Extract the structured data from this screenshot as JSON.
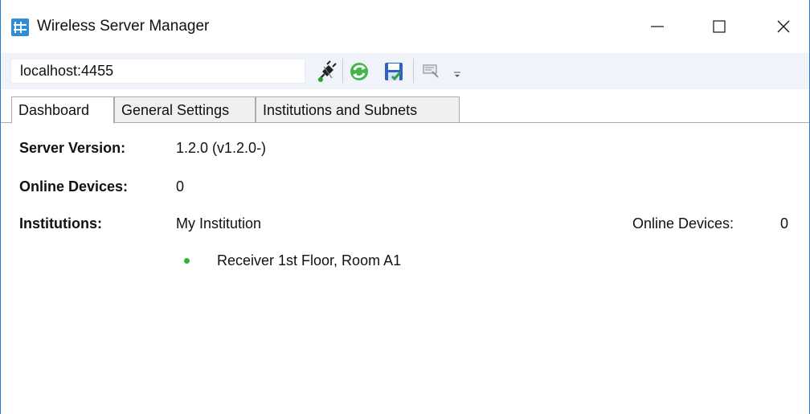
{
  "window": {
    "title": "Wireless Server Manager"
  },
  "toolbar": {
    "server_address": "localhost:4455",
    "buttons": [
      {
        "name": "disconnect",
        "icon": "plug-icon"
      },
      {
        "name": "refresh",
        "icon": "refresh-icon"
      },
      {
        "name": "save",
        "icon": "save-icon"
      },
      {
        "name": "options",
        "icon": "options-icon"
      }
    ]
  },
  "tabs": [
    {
      "label": "Dashboard",
      "active": true
    },
    {
      "label": "General Settings",
      "active": false
    },
    {
      "label": "Institutions and Subnets",
      "active": false
    }
  ],
  "dashboard": {
    "server_version_label": "Server Version:",
    "server_version_value": "1.2.0 (v1.2.0-)",
    "online_devices_label": "Online Devices:",
    "online_devices_value": "0",
    "institutions_label": "Institutions:",
    "institutions": [
      {
        "name": "My Institution",
        "online_devices_label": "Online Devices:",
        "online_devices_value": "0",
        "devices": [
          {
            "name": "Receiver 1st Floor, Room A1",
            "status_color": "#37b03a"
          }
        ]
      }
    ]
  },
  "colors": {
    "accent": "#2b7bd6",
    "toolbar_bg": "#f0f4fa",
    "online": "#37b03a"
  }
}
